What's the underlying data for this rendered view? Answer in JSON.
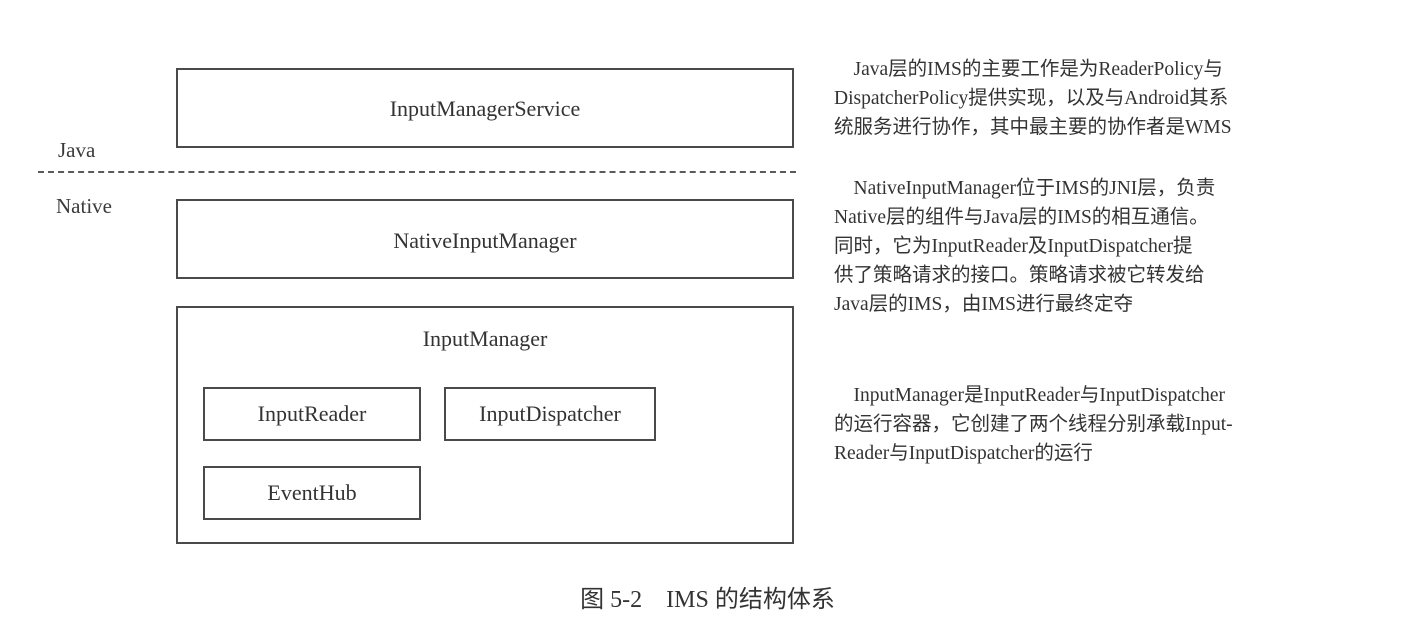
{
  "layers": {
    "java_label": "Java",
    "native_label": "Native"
  },
  "boxes": {
    "input_manager_service": "InputManagerService",
    "native_input_manager": "NativeInputManager",
    "input_manager": "InputManager",
    "input_reader": "InputReader",
    "input_dispatcher": "InputDispatcher",
    "event_hub": "EventHub"
  },
  "descriptions": [
    {
      "lines": [
        "　Java层的IMS的主要工作是为ReaderPolicy与",
        "DispatcherPolicy提供实现，以及与Android其系",
        "统服务进行协作，其中最主要的协作者是WMS"
      ]
    },
    {
      "lines": [
        "　NativeInputManager位于IMS的JNI层，负责",
        "Native层的组件与Java层的IMS的相互通信。",
        "同时，它为InputReader及InputDispatcher提",
        "供了策略请求的接口。策略请求被它转发给",
        "Java层的IMS，由IMS进行最终定夺"
      ]
    },
    {
      "lines": [
        "　InputManager是InputReader与InputDispatcher",
        "的运行容器，它创建了两个线程分别承载Input-",
        "Reader与InputDispatcher的运行"
      ]
    }
  ],
  "caption": "图 5-2　IMS 的结构体系"
}
